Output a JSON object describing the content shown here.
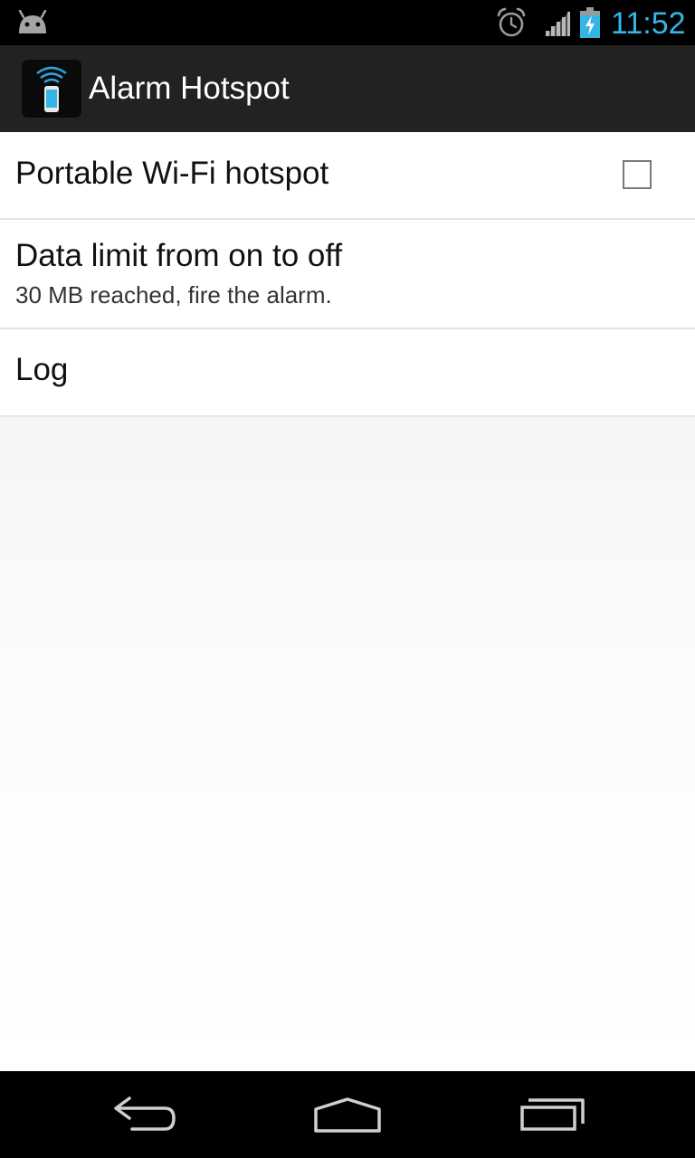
{
  "status_bar": {
    "time": "11:52",
    "icons": [
      "android-icon",
      "alarm-clock-icon",
      "signal-icon",
      "battery-charging-icon"
    ],
    "clock_color": "#33b5e5"
  },
  "action_bar": {
    "title": "Alarm Hotspot",
    "app_icon": "wifi-phone-icon",
    "background": "#222222"
  },
  "preferences": [
    {
      "title": "Portable Wi-Fi hotspot",
      "checked": false
    },
    {
      "title": "Data limit from on to off",
      "summary": "30 MB reached, fire the alarm."
    },
    {
      "title": "Log"
    }
  ],
  "nav_bar": {
    "buttons": [
      "back-icon",
      "home-icon",
      "recent-apps-icon"
    ]
  }
}
